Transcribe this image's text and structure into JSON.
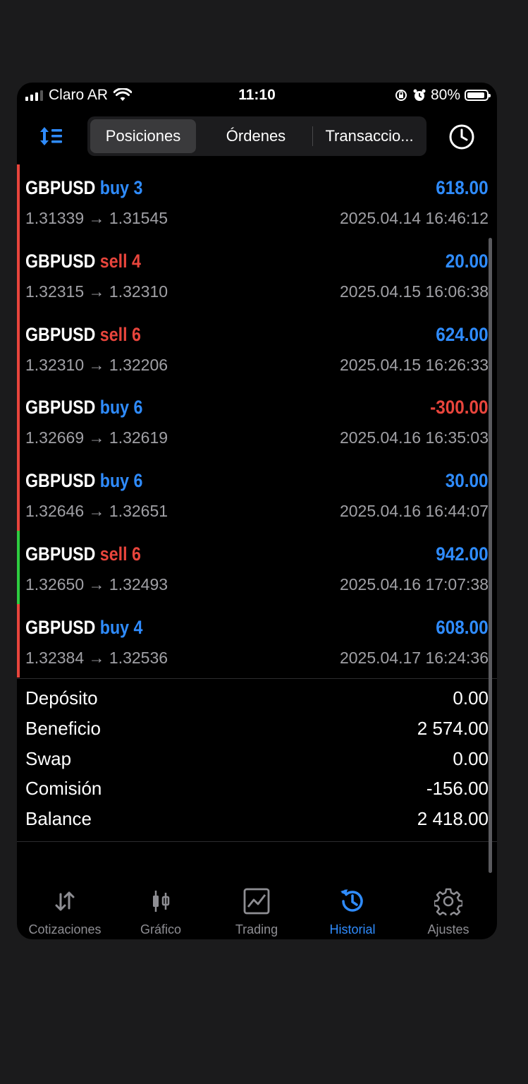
{
  "status_bar": {
    "carrier": "Claro AR",
    "time": "11:10",
    "battery": "80%"
  },
  "header": {
    "tabs": [
      {
        "label": "Posiciones",
        "active": true
      },
      {
        "label": "Órdenes",
        "active": false
      },
      {
        "label": "Transaccio...",
        "active": false
      }
    ]
  },
  "deals": [
    {
      "symbol": "GBPUSD",
      "side": "buy 3",
      "type": "buy",
      "profit": "618.00",
      "prices": "1.31339 → 1.31545",
      "time": "2025.04.14 16:46:12",
      "indicator_color": "#e8453c"
    },
    {
      "symbol": "GBPUSD",
      "side": "sell 4",
      "type": "sell",
      "profit": "20.00",
      "prices": "1.32315 → 1.32310",
      "time": "2025.04.15 16:06:38",
      "indicator_color": "#e8453c"
    },
    {
      "symbol": "GBPUSD",
      "side": "sell 6",
      "type": "sell",
      "profit": "624.00",
      "prices": "1.32310 → 1.32206",
      "time": "2025.04.15 16:26:33",
      "indicator_color": "#e8453c"
    },
    {
      "symbol": "GBPUSD",
      "side": "buy 6",
      "type": "buy",
      "profit": "-300.00",
      "prices": "1.32669 → 1.32619",
      "time": "2025.04.16 16:35:03",
      "indicator_color": "#e8453c"
    },
    {
      "symbol": "GBPUSD",
      "side": "buy 6",
      "type": "buy",
      "profit": "30.00",
      "prices": "1.32646 → 1.32651",
      "time": "2025.04.16 16:44:07",
      "indicator_color": "#e8453c"
    },
    {
      "symbol": "GBPUSD",
      "side": "sell 6",
      "type": "sell",
      "profit": "942.00",
      "prices": "1.32650 → 1.32493",
      "time": "2025.04.16 17:07:38",
      "indicator_color": "#2ecc40"
    },
    {
      "symbol": "GBPUSD",
      "side": "buy 4",
      "type": "buy",
      "profit": "608.00",
      "prices": "1.32384 → 1.32536",
      "time": "2025.04.17 16:24:36",
      "indicator_color": "#e8453c"
    }
  ],
  "summary": [
    {
      "label": "Depósito",
      "value": "0.00"
    },
    {
      "label": "Beneficio",
      "value": "2 574.00"
    },
    {
      "label": "Swap",
      "value": "0.00"
    },
    {
      "label": "Comisión",
      "value": "-156.00"
    },
    {
      "label": "Balance",
      "value": "2 418.00"
    }
  ],
  "tab_bar": [
    {
      "label": "Cotizaciones",
      "icon": "quotes-arrows-icon",
      "active": false
    },
    {
      "label": "Gráfico",
      "icon": "candlestick-icon",
      "active": false
    },
    {
      "label": "Trading",
      "icon": "trading-chart-icon",
      "active": false
    },
    {
      "label": "Historial",
      "icon": "history-icon",
      "active": true
    },
    {
      "label": "Ajustes",
      "icon": "gear-icon",
      "active": false
    }
  ],
  "colors": {
    "accent": "#2f8cff",
    "sell": "#e8453c",
    "background": "#000000"
  }
}
